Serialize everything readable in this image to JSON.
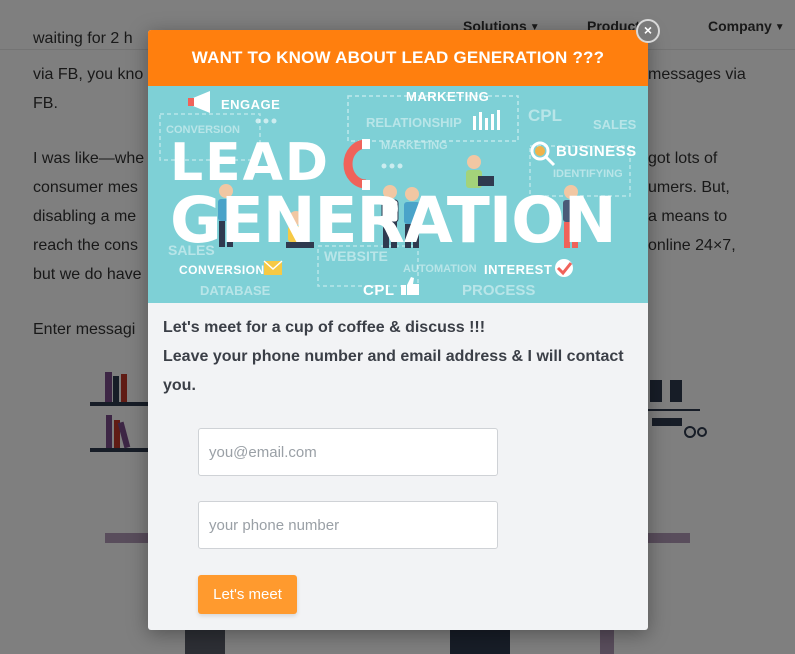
{
  "nav": {
    "items": [
      {
        "label": "Solutions"
      },
      {
        "label": "Products"
      },
      {
        "label": "Company"
      }
    ]
  },
  "article": {
    "lines": [
      "waiting for 2 h",
      "via FB, you kno",
      "messages via",
      "FB.",
      "I was like—whe",
      "got lots of",
      "consumer mes",
      "umers. But,",
      "disabling a me",
      "a means to",
      "reach the cons",
      "online 24×7,",
      "but we do have",
      "Enter messagi"
    ]
  },
  "modal": {
    "title": "WANT TO KNOW ABOUT LEAD GENERATION ???",
    "message_line1": "Let's meet for a cup of coffee & discuss !!!",
    "message_line2": "Leave your phone number and email address & I will contact you.",
    "email_placeholder": "you@email.com",
    "phone_placeholder": "your phone number",
    "submit_label": "Let's meet",
    "close_label": "×",
    "banner": {
      "big_line1": "LEAD",
      "big_line2": "GENERATION",
      "labels": {
        "engage": "ENGAGE",
        "marketing": "MARKETING",
        "business": "BUSINESS",
        "conversion": "CONVERSION",
        "interest": "INTEREST",
        "cpl": "CPL"
      },
      "faint": {
        "conversion": "CONVERSION",
        "relationship": "RELATIONSHIP",
        "marketing": "MARKETING",
        "sales": "SALES",
        "identifying": "IDENTIFYING",
        "cpl": "CPL",
        "website": "WEBSITE",
        "automation": "AUTOMATION",
        "database": "DATABASE",
        "process": "PROCESS",
        "sales2": "SALES"
      }
    }
  },
  "colors": {
    "accent": "#ff7f0e",
    "button": "#ff9a2e",
    "banner_bg": "#7ed0d6",
    "magnet": "#f0625a"
  }
}
